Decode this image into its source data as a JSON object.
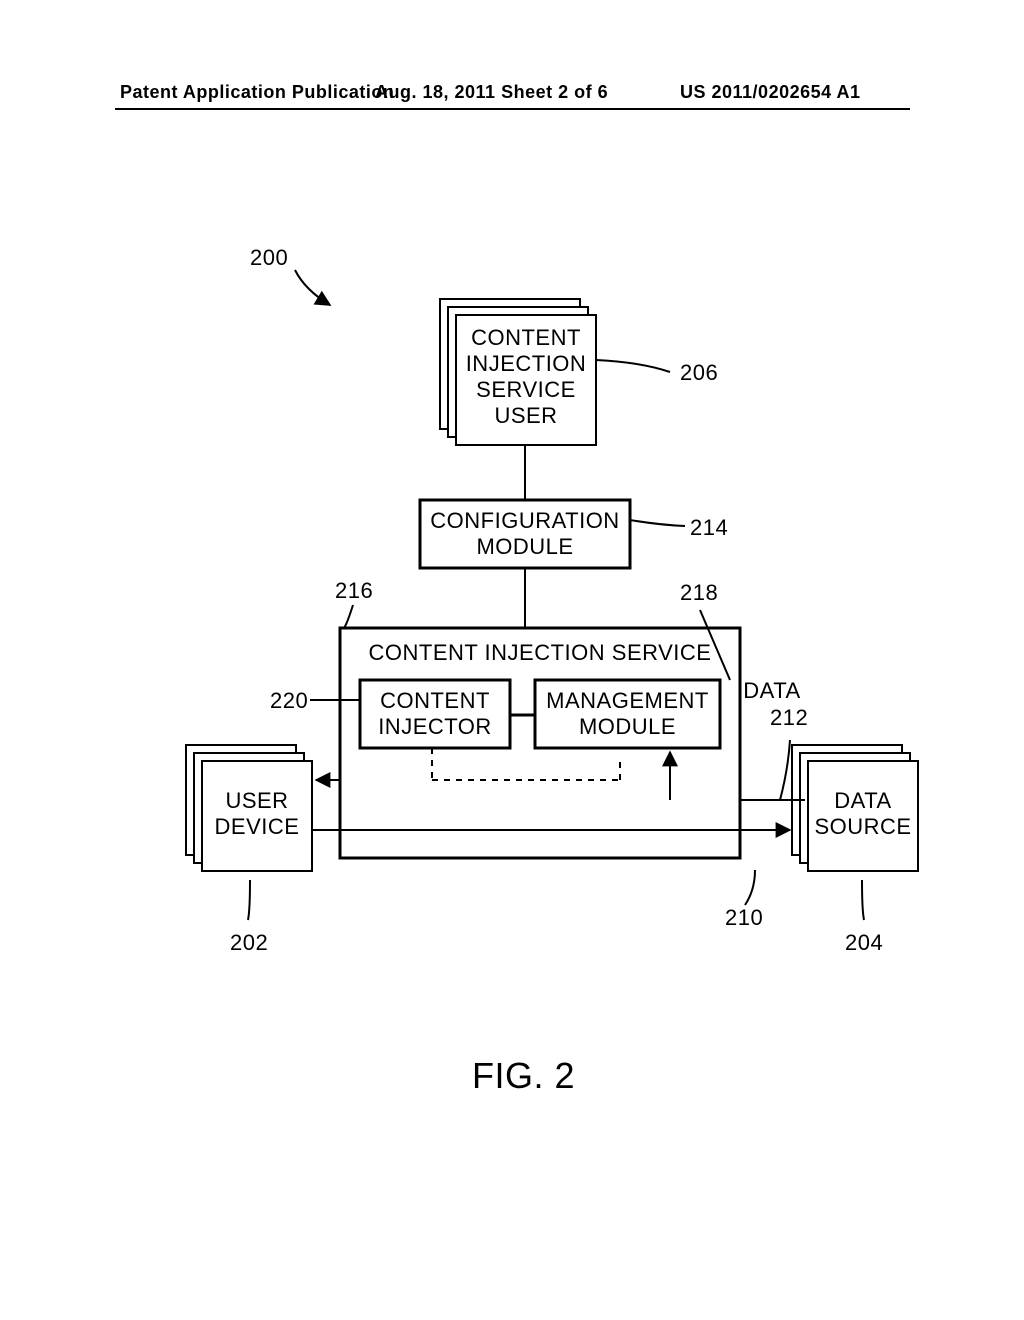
{
  "header": {
    "left": "Patent Application Publication",
    "mid": "Aug. 18, 2011  Sheet 2 of 6",
    "right": "US 2011/0202654 A1"
  },
  "refs": {
    "r200": "200",
    "r202": "202",
    "r204": "204",
    "r206": "206",
    "r210": "210",
    "r212": "212",
    "r214": "214",
    "r216": "216",
    "r218": "218",
    "r220": "220"
  },
  "boxes": {
    "cis_user": "CONTENT\nINJECTION\nSERVICE\nUSER",
    "config": "CONFIGURATION\nMODULE",
    "service": "CONTENT INJECTION SERVICE",
    "injector": "CONTENT\nINJECTOR",
    "mgmt": "MANAGEMENT\nMODULE",
    "data": "DATA",
    "user_device": "USER\nDEVICE",
    "data_source": "DATA\nSOURCE"
  },
  "figure": "FIG. 2"
}
